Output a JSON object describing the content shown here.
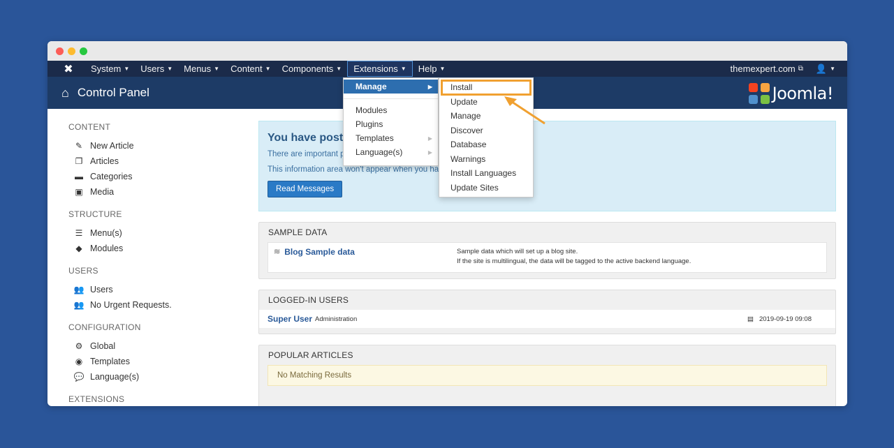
{
  "navbar": {
    "items": [
      {
        "label": "System"
      },
      {
        "label": "Users"
      },
      {
        "label": "Menus"
      },
      {
        "label": "Content"
      },
      {
        "label": "Components"
      },
      {
        "label": "Extensions"
      },
      {
        "label": "Help"
      }
    ],
    "site_link": "themexpert.com"
  },
  "header": {
    "title": "Control Panel",
    "logo_text": "Joomla!"
  },
  "sidebar": {
    "sections": [
      {
        "title": "CONTENT",
        "items": [
          {
            "label": "New Article",
            "icon": "pencil-icon"
          },
          {
            "label": "Articles",
            "icon": "copy-icon"
          },
          {
            "label": "Categories",
            "icon": "folder-icon"
          },
          {
            "label": "Media",
            "icon": "image-icon"
          }
        ]
      },
      {
        "title": "STRUCTURE",
        "items": [
          {
            "label": "Menu(s)",
            "icon": "list-icon"
          },
          {
            "label": "Modules",
            "icon": "cube-icon"
          }
        ]
      },
      {
        "title": "USERS",
        "items": [
          {
            "label": "Users",
            "icon": "users-icon"
          },
          {
            "label": "No Urgent Requests.",
            "icon": "users-icon"
          }
        ]
      },
      {
        "title": "CONFIGURATION",
        "items": [
          {
            "label": "Global",
            "icon": "gear-icon"
          },
          {
            "label": "Templates",
            "icon": "eye-icon"
          },
          {
            "label": "Language(s)",
            "icon": "comments-icon"
          }
        ]
      },
      {
        "title": "EXTENSIONS",
        "items": []
      }
    ]
  },
  "alert": {
    "title": "You have post-",
    "line1": "There are important po",
    "line2": "This information area won't appear when you have",
    "button": "Read Messages"
  },
  "sample_data": {
    "header": "SAMPLE DATA",
    "name": "Blog Sample data",
    "desc1": "Sample data which will set up a blog site.",
    "desc2": "If the site is multilingual, the data will be tagged to the active backend language."
  },
  "logged_in": {
    "header": "LOGGED-IN USERS",
    "user": "Super User",
    "role": "Administration",
    "date": "2019-09-19 09:08"
  },
  "popular": {
    "header": "POPULAR ARTICLES",
    "empty": "No Matching Results"
  },
  "extensions_menu": {
    "manage": "Manage",
    "items": [
      "Modules",
      "Plugins",
      "Templates",
      "Language(s)"
    ]
  },
  "manage_submenu": {
    "items": [
      "Install",
      "Update",
      "Manage",
      "Discover",
      "Database",
      "Warnings",
      "Install Languages",
      "Update Sites"
    ]
  },
  "colors": {
    "highlight": "#f0a030",
    "navbar": "#1b2b4a",
    "header": "#1d3b66"
  }
}
